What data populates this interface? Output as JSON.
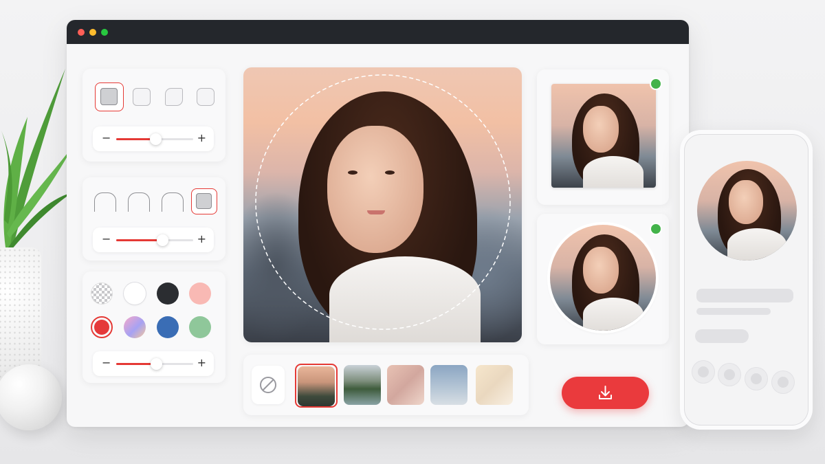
{
  "window": {
    "title_bar_buttons": [
      "close",
      "minimize",
      "maximize"
    ]
  },
  "shape_panel": {
    "options": [
      "square",
      "rounded-square",
      "cut-corner",
      "soft-square"
    ],
    "selected": "square",
    "slider_value": 0.55
  },
  "frame_panel": {
    "options": [
      "arch",
      "arch",
      "arch",
      "square"
    ],
    "selected": "square",
    "slider_value": 0.6
  },
  "color_panel": {
    "swatches": [
      {
        "name": "transparent",
        "color": "checker"
      },
      {
        "name": "white",
        "color": "#ffffff"
      },
      {
        "name": "black",
        "color": "#2b2d31"
      },
      {
        "name": "pink",
        "color": "#f9b9b4"
      },
      {
        "name": "red",
        "color": "#e5393a"
      },
      {
        "name": "gradient",
        "color": "#c6a0e8"
      },
      {
        "name": "blue",
        "color": "#3a6db5"
      },
      {
        "name": "green",
        "color": "#8fc79a"
      }
    ],
    "selected": "red",
    "slider_value": 0.52
  },
  "preview": {
    "crop_guide": "circle"
  },
  "side_previews": [
    {
      "shape": "square",
      "status": "active"
    },
    {
      "shape": "circle",
      "status": "active"
    }
  ],
  "backgrounds": {
    "options": [
      "none",
      "sunset-beach",
      "lake-forest",
      "blush-blur",
      "blue-sky",
      "cream-blur"
    ],
    "selected": "sunset-beach"
  },
  "colors": {
    "accent": "#e53935",
    "status_active": "#43b34a",
    "titlebar": "#24272c"
  }
}
